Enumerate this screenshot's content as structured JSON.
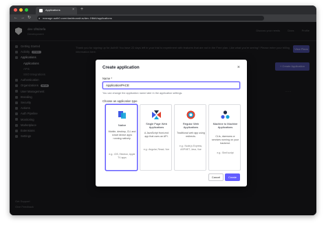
{
  "browser": {
    "tab_title": "Applications",
    "tab_close": "×",
    "new_tab": "+",
    "back": "←",
    "forward": "→",
    "reload": "↻",
    "url": "manage.auth0.com/dashboard/us/dev-1f8d4/applications",
    "lock": "🔒",
    "dot_colors": [
      "#ff5f57",
      "#febc2e",
      "#28c840"
    ]
  },
  "app": {
    "tenant_name": "dev-1f8d4efa",
    "tenant_sub": "Development",
    "top_links": [
      "Discuss your needs",
      "Docs",
      "Profile"
    ]
  },
  "sidebar": {
    "items": [
      {
        "label": "Getting Started",
        "sub": false,
        "active": false
      },
      {
        "label": "Activity",
        "badge": "FREE",
        "sub": false,
        "active": false
      },
      {
        "label": "Applications",
        "sub": false,
        "active": true
      },
      {
        "label": "Applications",
        "sub": true,
        "active": true
      },
      {
        "label": "APIs",
        "sub": true,
        "active": false
      },
      {
        "label": "SSO Integrations",
        "sub": true,
        "active": false
      },
      {
        "label": "Authentication",
        "sub": false,
        "active": false
      },
      {
        "label": "Organizations",
        "badge": "NEW",
        "sub": false,
        "active": false
      },
      {
        "label": "User Management",
        "sub": false,
        "active": false
      },
      {
        "label": "Branding",
        "sub": false,
        "active": false
      },
      {
        "label": "Security",
        "sub": false,
        "active": false
      },
      {
        "label": "Actions",
        "sub": false,
        "active": false
      },
      {
        "label": "Auth Pipeline",
        "sub": false,
        "active": false
      },
      {
        "label": "Monitoring",
        "sub": false,
        "active": false
      },
      {
        "label": "Marketplace",
        "sub": false,
        "active": false
      },
      {
        "label": "Extensions",
        "sub": false,
        "active": false
      },
      {
        "label": "Settings",
        "sub": false,
        "active": false
      }
    ],
    "bottom": [
      "Get Support",
      "Give Feedback"
    ]
  },
  "main": {
    "banner": "Thank you for signing up for Auth0! You have 22 days left in your trial to experiment with features that are not in the Free plan. Like what you're seeing? Please enter your billing information here.",
    "banner_button": "View Plans",
    "create_button": "+ Create Application",
    "more": "···"
  },
  "modal": {
    "title": "Create application",
    "close": "×",
    "name_label": "Name *",
    "name_value": "ApplicationPACE",
    "name_help": "You can change the application name later in the application settings.",
    "type_label": "Choose an application type",
    "cards": [
      {
        "title": "Native",
        "desc": "Mobile, desktop, CLI and smart device apps running natively.",
        "eg": "e.g.: iOS, Electron, Apple TV apps",
        "selected": true
      },
      {
        "title": "Single Page Web Applications",
        "desc": "A JavaScript front-end app that uses an API.",
        "eg": "e.g.: Angular, React, Vue",
        "selected": false
      },
      {
        "title": "Regular Web Applications",
        "desc": "Traditional web app using redirects.",
        "eg": "e.g.: Node.js Express, ASP.NET, Java, Vue",
        "selected": false
      },
      {
        "title": "Machine to Machine Applications",
        "desc": "CLIs, daemons or services running on your backend.",
        "eg": "e.g.: Shell script",
        "selected": false
      }
    ],
    "cancel": "Cancel",
    "create": "Create",
    "accent": "#635dff"
  }
}
